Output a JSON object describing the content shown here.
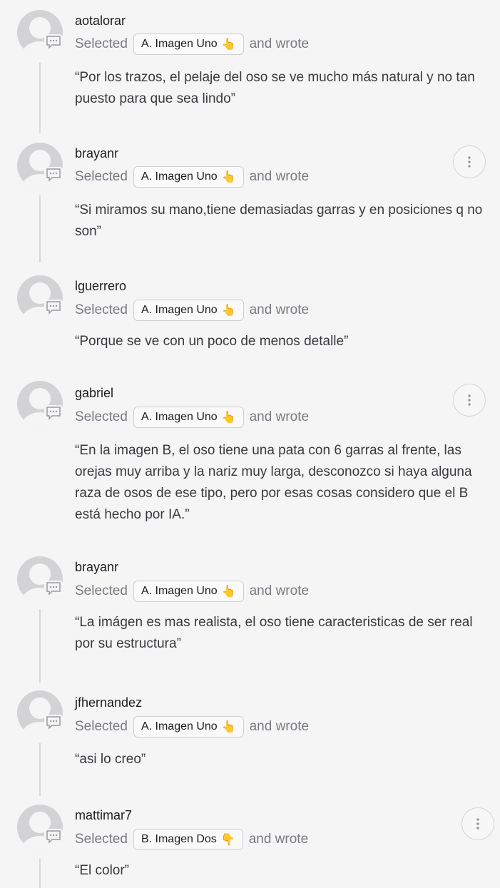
{
  "common": {
    "selected_label": "Selected",
    "wrote_label": "and wrote"
  },
  "entries": [
    {
      "username": "aotalorar",
      "choice": "A. Imagen Uno",
      "hand": "👆",
      "comment": "“Por los trazos, el pelaje del oso se ve mucho más natural y no tan puesto para que sea lindo”",
      "has_more": false
    },
    {
      "username": "brayanr",
      "choice": "A. Imagen Uno",
      "hand": "👆",
      "comment": "“Si miramos su mano,tiene demasiadas garras y en posiciones q no son”",
      "has_more": true
    },
    {
      "username": "lguerrero",
      "choice": "A. Imagen Uno",
      "hand": "👆",
      "comment": "“Porque se ve con un poco de menos detalle”",
      "has_more": false
    },
    {
      "username": "gabriel",
      "choice": "A. Imagen Uno",
      "hand": "👆",
      "comment": "“En la imagen B, el oso tiene una pata con 6 garras al frente, las orejas muy arriba y la nariz muy larga, desconozco si haya alguna raza de osos de ese tipo, pero por esas cosas considero que el B está hecho por IA.”",
      "has_more": true
    },
    {
      "username": "brayanr",
      "choice": "A. Imagen Uno",
      "hand": "👆",
      "comment": "“La imágen es mas realista, el oso tiene caracteristicas de ser real por su estructura”",
      "has_more": false
    },
    {
      "username": "jfhernandez",
      "choice": "A. Imagen Uno",
      "hand": "👆",
      "comment": "“asi lo creo”",
      "has_more": false
    },
    {
      "username": "mattimar7",
      "choice": "B. Imagen Dos",
      "hand": "👇",
      "comment": "“El color”",
      "has_more": true
    }
  ],
  "icons": {
    "avatar": "default-user-avatar",
    "comment": "comment-bubble-icon",
    "more": "vertical-ellipsis-icon"
  },
  "colors": {
    "background": "#f5f5f6",
    "avatar": "#d3d3d5",
    "chip_border": "#cfcfd3",
    "secondary_text": "#7a7a80"
  }
}
